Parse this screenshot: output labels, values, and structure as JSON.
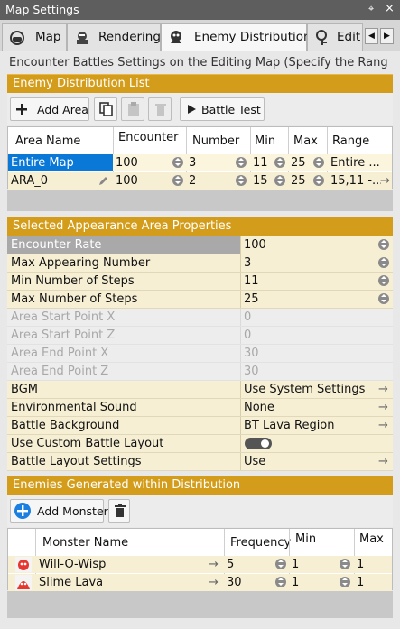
{
  "window": {
    "title": "Map Settings",
    "pin_glyph": "⌖",
    "close_glyph": "×"
  },
  "tabs": [
    {
      "label": "Map",
      "icon": "map-icon"
    },
    {
      "label": "Rendering",
      "icon": "rendering-icon"
    },
    {
      "label": "Enemy Distribution",
      "icon": "enemy-icon",
      "active": true
    },
    {
      "label": "Edit",
      "icon": "edit-icon"
    }
  ],
  "tab_nav": {
    "prev": "◀",
    "next": "▶"
  },
  "description": "Encounter Battles Settings on the Editing Map (Specify the Rang",
  "distribution_list": {
    "title": "Enemy Distribution List",
    "add_area_label": "Add Area",
    "battle_test_label": "Battle Test",
    "columns": [
      "Area Name",
      "Encounter",
      "Number",
      "Min",
      "Max",
      "Range"
    ],
    "rows": [
      {
        "name": "Entire Map",
        "encounter": "100",
        "number": "3",
        "min": "11",
        "max": "25",
        "range": "Entire ...",
        "selected": true
      },
      {
        "name": "ARA_0",
        "encounter": "100",
        "number": "2",
        "min": "15",
        "max": "25",
        "range": "15,11 -..."
      }
    ]
  },
  "properties": {
    "title": "Selected Appearance Area Properties",
    "rows": [
      {
        "key": "Encounter Rate",
        "value": "100",
        "control": "spin",
        "selected": true
      },
      {
        "key": "Max Appearing Number",
        "value": "3",
        "control": "spin"
      },
      {
        "key": "Min Number of Steps",
        "value": "11",
        "control": "spin"
      },
      {
        "key": "Max Number of Steps",
        "value": "25",
        "control": "spin"
      },
      {
        "key": "Area Start Point X",
        "value": "0",
        "disabled": true
      },
      {
        "key": "Area Start Point Z",
        "value": "0",
        "disabled": true
      },
      {
        "key": "Area End Point X",
        "value": "30",
        "disabled": true
      },
      {
        "key": "Area End Point Z",
        "value": "30",
        "disabled": true
      },
      {
        "key": "BGM",
        "value": "Use System Settings",
        "control": "arrow"
      },
      {
        "key": "Environmental Sound",
        "value": "None",
        "control": "arrow"
      },
      {
        "key": "Battle Background",
        "value": "BT Lava Region",
        "control": "arrow"
      },
      {
        "key": "Use Custom Battle Layout",
        "value": "",
        "control": "toggle"
      },
      {
        "key": "Battle Layout Settings",
        "value": "Use",
        "control": "arrow"
      }
    ]
  },
  "monsters": {
    "title": "Enemies Generated within Distribution",
    "add_monster_label": "Add Monster",
    "columns": [
      "Monster Name",
      "Frequency",
      "Min",
      "Max"
    ],
    "rows": [
      {
        "name": "Will-O-Wisp",
        "frequency": "5",
        "min": "1",
        "max": "1"
      },
      {
        "name": "Slime Lava",
        "frequency": "30",
        "min": "1",
        "max": "1"
      }
    ]
  },
  "colors": {
    "section": "#d39d1b",
    "selected": "#0a78d7",
    "prop_bg": "#f6efd4"
  }
}
